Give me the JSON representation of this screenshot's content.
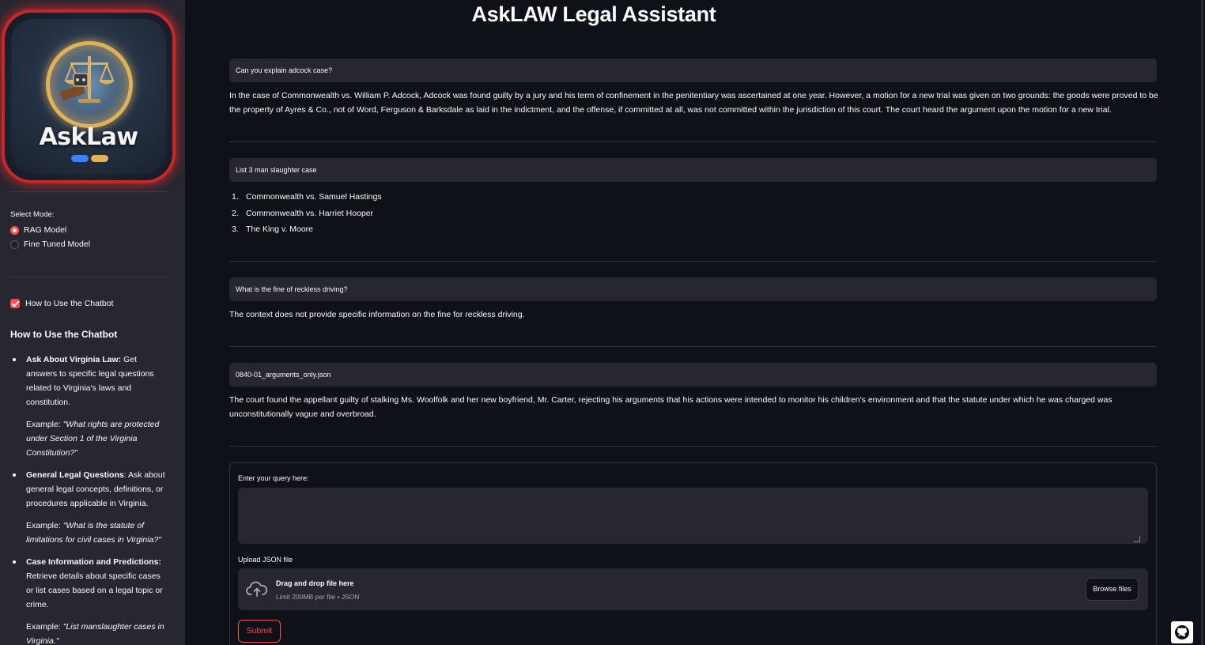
{
  "sidebar": {
    "logo": {
      "wordmark": "AskLaw",
      "colors": {
        "glow": "#e53935",
        "ring": "#e0b15a",
        "bubble_blue": "#3b82f6",
        "bubble_gold": "#e0b15a"
      }
    },
    "mode": {
      "label": "Select Mode:",
      "options": [
        {
          "label": "RAG Model",
          "selected": true
        },
        {
          "label": "Fine Tuned Model",
          "selected": false
        }
      ]
    },
    "show_howto": {
      "label": "How to Use the Chatbot",
      "checked": true
    },
    "howto": {
      "title": "How to Use the Chatbot",
      "items": [
        {
          "heading": "Ask About Virginia Law:",
          "text": " Get answers to specific legal questions related to Virginia's laws and constitution.",
          "example_prefix": "Example: ",
          "example": "\"What rights are protected under Section 1 of the Virginia Constitution?\""
        },
        {
          "heading": "General Legal Questions",
          "text": ": Ask about general legal concepts, definitions, or procedures applicable in Virginia.",
          "example_prefix": "Example: ",
          "example": "\"What is the statute of limitations for civil cases in Virginia?\""
        },
        {
          "heading": "Case Information and Predictions:",
          "text": " Retrieve details about specific cases or list cases based on a legal topic or crime.",
          "example_prefix": "Example: ",
          "example": "\"List manslaughter cases in Virginia.\""
        }
      ]
    }
  },
  "main": {
    "title": "AskLAW Legal Assistant",
    "chat": [
      {
        "question": "Can you explain adcock case?",
        "answer": "In the case of Commonwealth vs. William P. Adcock, Adcock was found guilty by a jury and his term of confinement in the penitentiary was ascertained at one year. However, a motion for a new trial was given on two grounds: the goods were proved to be the property of Ayres & Co., not of Word, Ferguson & Barksdale as laid in the indictment, and the offense, if committed at all, was not committed within the jurisdiction of this court. The court heard the argument upon the motion for a new trial."
      },
      {
        "question": "List 3 man slaughter case",
        "answer_list": [
          {
            "num": "1.",
            "text": "Commonwealth vs. Samuel Hastings"
          },
          {
            "num": "2.",
            "text": "Commonwealth vs. Harriet Hooper"
          },
          {
            "num": "3.",
            "text": "The King v. Moore"
          }
        ]
      },
      {
        "question": "What is the fine of reckless driving?",
        "answer": "The context does not provide specific information on the fine for reckless driving."
      },
      {
        "question": "0840-01_arguments_only.json",
        "answer": "The court found the appellant guilty of stalking Ms. Woolfolk and her new boyfriend, Mr. Carter, rejecting his arguments that his actions were intended to monitor his children's environment and that the statute under which he was charged was unconstitutionally vague and overbroad."
      }
    ],
    "form": {
      "query_label": "Enter your query here:",
      "query_value": "",
      "upload_label": "Upload JSON file",
      "drop_title": "Drag and drop file here",
      "drop_limit": "Limit 200MB per file • JSON",
      "browse_label": "Browse files",
      "submit_label": "Submit"
    }
  },
  "theme": {
    "accent": "#ff4b4b",
    "background": "#0e1117",
    "secondary_bg": "#262730"
  },
  "icons": {
    "upload": "cloud-upload-icon",
    "github": "github-icon"
  }
}
